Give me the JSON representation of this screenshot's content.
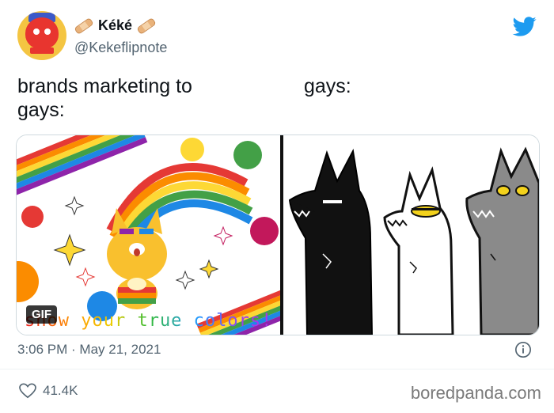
{
  "tweet": {
    "display_name": "Kéké",
    "handle": "@Kekeflipnote",
    "caption_left": "brands marketing to gays:",
    "caption_right": "gays:",
    "timestamp": "3:06 PM · May 21, 2021",
    "like_count": "41.4K"
  },
  "media": {
    "gif_badge": "GIF",
    "slogan": "show your true colors!"
  },
  "watermark": "boredpanda.com",
  "colors": {
    "twitter_blue": "#1d9bf0",
    "secondary_text": "#536471",
    "rainbow": [
      "#e53935",
      "#fb8c00",
      "#fdd835",
      "#43a047",
      "#1e88e5",
      "#8e24aa"
    ]
  },
  "icons": {
    "brand": "twitter-bird-icon",
    "info": "info-icon",
    "like": "heart-outline-icon",
    "decor": "bandage-icon"
  }
}
